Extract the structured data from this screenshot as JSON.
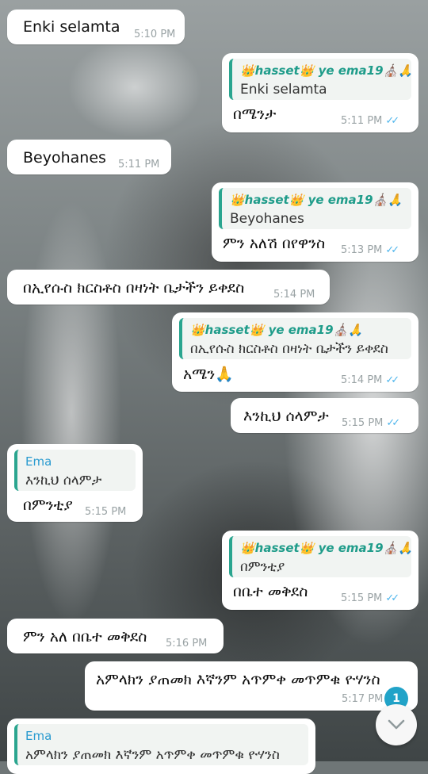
{
  "reply_sender": "👑hasset👑 ye ema19⛪🙏",
  "reply_sender_short": "Ema",
  "messages": [
    {
      "text": "Enki selamta",
      "time": "5:10 PM"
    },
    {
      "quote": "Enki selamta",
      "text": "በሜንታ",
      "time": "5:11 PM"
    },
    {
      "text": "Beyohanes",
      "time": "5:11 PM"
    },
    {
      "quote": "Beyohanes",
      "text": "ምን አለሽ በየዋንስ",
      "time": "5:13 PM"
    },
    {
      "text": "በኢየሱስ ክርስቶስ በዛነት ቤታችን ይቀደስ",
      "time": "5:14 PM"
    },
    {
      "quote": "በኢየሱስ ክርስቶስ በዛነት ቤታችን ይቀደስ",
      "text": "አሜን🙏",
      "time": "5:14 PM"
    },
    {
      "text": "እንኪህ ሰላምታ",
      "time": "5:15 PM"
    },
    {
      "quote": "እንኪህ ሰላምታ",
      "text": "በምንቲያ",
      "time": "5:15 PM"
    },
    {
      "quote": "በምንቲያ",
      "text": "በቤተ መቅደስ",
      "time": "5:15 PM"
    },
    {
      "text": "ምን አለ በቤተ መቅደስ",
      "time": "5:16 PM"
    },
    {
      "text": "አምላክን ያጠመክ እኛንም አጥምቀ መጥምቁ ዮሃንስ",
      "time": "5:17 PM"
    },
    {
      "quote": "አምላክን ያጠመክ እኛንም አጥምቀ መጥምቁ ዮሃንስ"
    }
  ],
  "unread_count": "1",
  "icons": {
    "read": "double-check-icon",
    "scroll": "chevron-down-icon"
  }
}
